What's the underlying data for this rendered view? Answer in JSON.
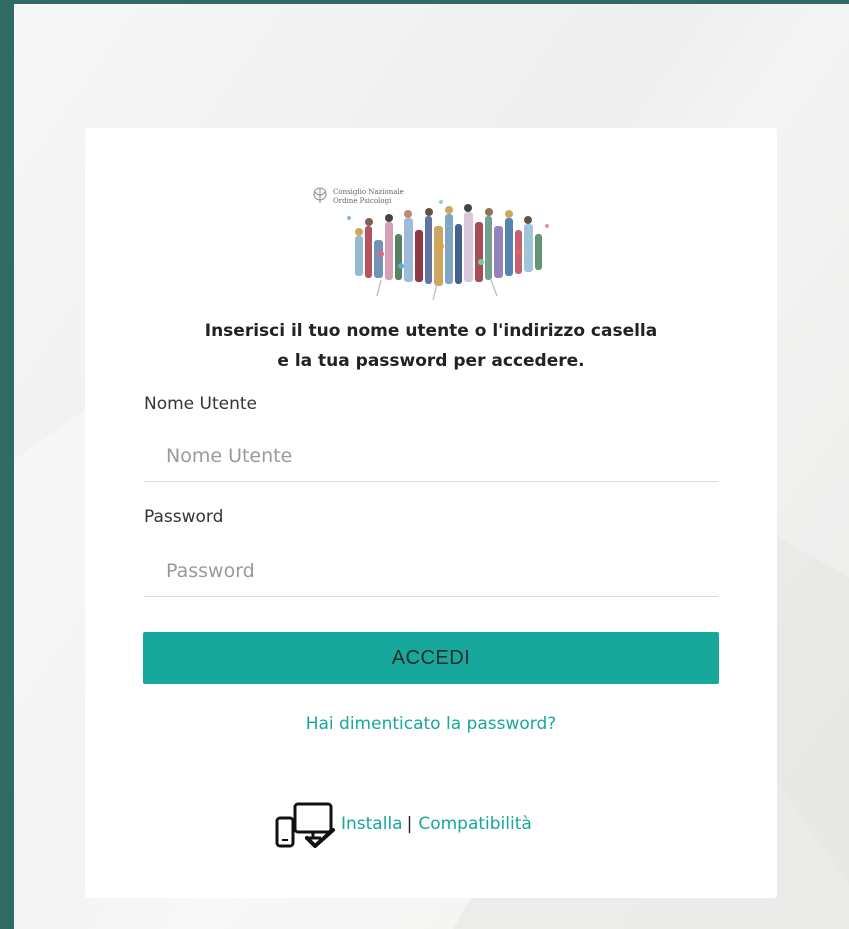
{
  "logo": {
    "org_name_line1": "Consiglio Nazionale",
    "org_name_line2": "Ordine Psicologi"
  },
  "login": {
    "title_line1": "Inserisci il tuo nome utente o l'indirizzo casella",
    "title_line2": "e la tua password per accedere.",
    "username_label": "Nome Utente",
    "username_placeholder": "Nome Utente",
    "username_value": "",
    "password_label": "Password",
    "password_placeholder": "Password",
    "password_value": "",
    "submit_label": "ACCEDI",
    "forgot_label": "Hai dimenticato la password?"
  },
  "footer": {
    "icon": "devices-check-icon",
    "install_label": "Installa",
    "separator": "|",
    "compat_label": "Compatibilità"
  },
  "colors": {
    "accent": "#17a89b",
    "frame": "#2f6b63",
    "card": "#ffffff"
  }
}
